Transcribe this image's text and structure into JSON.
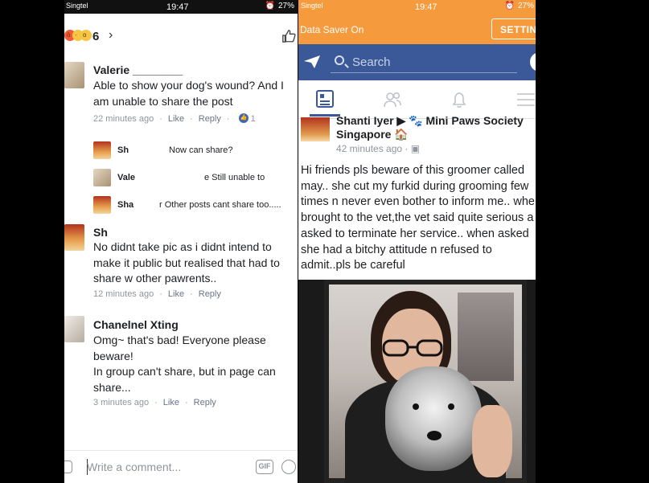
{
  "left": {
    "status": {
      "carrier": "Singtel",
      "time": "19:47",
      "battery": "27%"
    },
    "reactions": {
      "count": "6",
      "chevron": "›"
    },
    "comments": [
      {
        "name": "Valerie ________",
        "text": "Able to show your dog's wound? And I am unable to share the post",
        "time": "22 minutes ago",
        "like": "Like",
        "reply": "Reply",
        "likes": "1"
      },
      {
        "name": "Sh",
        "text": "No didnt take pic as i didnt intend to make it public but realised that had to share w other pawrents..",
        "time": "12 minutes ago",
        "like": "Like",
        "reply": "Reply"
      },
      {
        "name": "Chanelnel Xting",
        "text": "Omg~ that's bad! Everyone please beware!\nIn group can't share, but in page can share...",
        "time": "3 minutes ago",
        "like": "Like",
        "reply": "Reply"
      }
    ],
    "replies": [
      {
        "name": "Sh",
        "text": "Now can share?"
      },
      {
        "name": "Vale",
        "text": "e Still unable to"
      },
      {
        "name": "Sha",
        "text": "r Other posts cant share too....."
      }
    ],
    "write_placeholder": "Write a comment...",
    "gif_label": "GIF"
  },
  "right": {
    "status": {
      "carrier": "Singtel",
      "time": "19:47",
      "battery": "27%"
    },
    "data_saver": {
      "text": "Data Saver On",
      "button": "SETTING"
    },
    "search_placeholder": "Search",
    "post": {
      "author": "Shanti Iyer ▶ 🐾 Mini Paws Society Singapore 🏠",
      "time": "42 minutes ago",
      "body": "Hi friends pls beware of this groomer called may.. she cut my furkid during grooming few times n never even bother to inform me.. when brought to the vet,the vet said quite serious a asked to terminate her service.. when asked she had a bitchy attitude n refused to admit..pls be careful"
    }
  },
  "colors": {
    "fb_blue": "#3b5998",
    "data_saver_orange": "#f59a3d",
    "meta_gray": "#90949c"
  }
}
